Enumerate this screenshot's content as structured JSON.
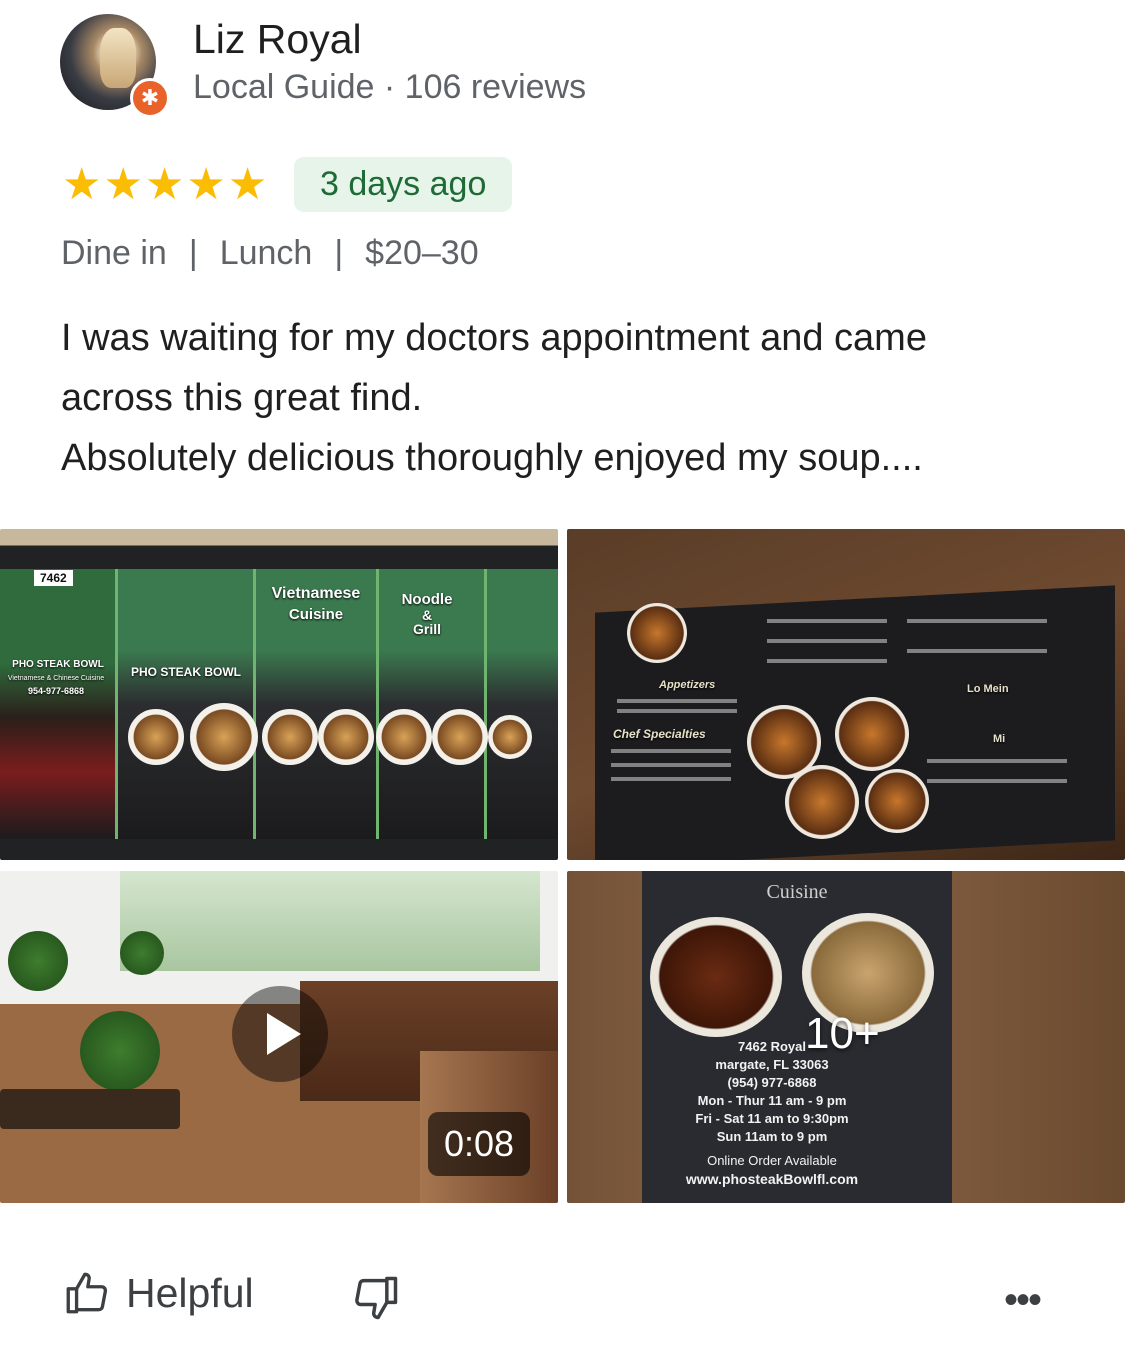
{
  "reviewer": {
    "name": "Liz Royal",
    "meta": "Local Guide · 106 reviews",
    "badge_icon": "local-guide-star-icon"
  },
  "rating": {
    "stars": 5,
    "max": 5,
    "star_color": "#fbbc04"
  },
  "posted": "3 days ago",
  "tags": [
    "Dine in",
    "Lunch",
    "$20–30"
  ],
  "review_lines": [
    "I was waiting for my doctors appointment and came",
    "across this great find.",
    "Absolutely delicious thoroughly enjoyed my soup...."
  ],
  "photos": {
    "storefront": {
      "number": "7462",
      "sign_vietnamese": "Vietnamese",
      "sign_cuisine": "Cuisine",
      "sign_noodle": "Noodle",
      "sign_amp": "&",
      "sign_grill": "Grill",
      "brand": "PHO STEAK BOWL",
      "door_brand": "PHO STEAK BOWL",
      "door_sub": "Vietnamese & Chinese Cuisine",
      "door_phone": "954-977-6868"
    },
    "menu": {
      "header_appetizers": "Appetizers",
      "header_chef": "Chef Specialties",
      "header_lo_mein": "Lo Mein",
      "header_mi": "Mi"
    },
    "interior_video": {
      "duration": "0:08",
      "play_icon": "play-icon"
    },
    "flyer": {
      "cuisine": "Cuisine",
      "address1": "7462 Royal",
      "address2": "margate, FL 33063",
      "phone": "(954) 977-6868",
      "hours1": "Mon - Thur 11 am - 9 pm",
      "hours2": "Fri - Sat 11 am  to 9:30pm",
      "hours3": "Sun 11am to 9 pm",
      "online": "Online Order Available",
      "url": "www.phosteakBowlfl.com",
      "more_count": "10+"
    }
  },
  "actions": {
    "helpful_label": "Helpful",
    "helpful_icon": "thumbs-up-icon",
    "not_helpful_icon": "thumbs-down-icon",
    "more_icon": "more-options-icon",
    "more_glyph": "•••"
  }
}
